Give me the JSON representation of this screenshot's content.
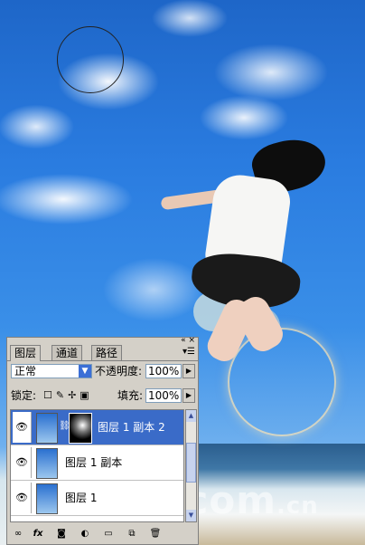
{
  "panel": {
    "titlebar_buttons": "« ×",
    "tabs": [
      {
        "label": "图层"
      },
      {
        "label": "通道"
      },
      {
        "label": "路径"
      }
    ],
    "menu_icon": "panel-menu-icon",
    "blend_mode": "正常",
    "opacity_label": "不透明度:",
    "opacity_value": "100%",
    "lock_label": "锁定:",
    "fill_label": "填充:",
    "fill_value": "100%",
    "layers": [
      {
        "name": "图层 1 副本 2",
        "selected": true
      },
      {
        "name": "图层 1 副本",
        "selected": false
      },
      {
        "name": "图层 1",
        "selected": false
      }
    ],
    "footer_icons": [
      "link-icon",
      "fx-icon",
      "mask-icon",
      "adjustment-icon",
      "group-folder-icon",
      "new-layer-icon",
      "trash-icon"
    ]
  },
  "watermark": {
    "main": "iTcom",
    "suffix": ".cn"
  }
}
